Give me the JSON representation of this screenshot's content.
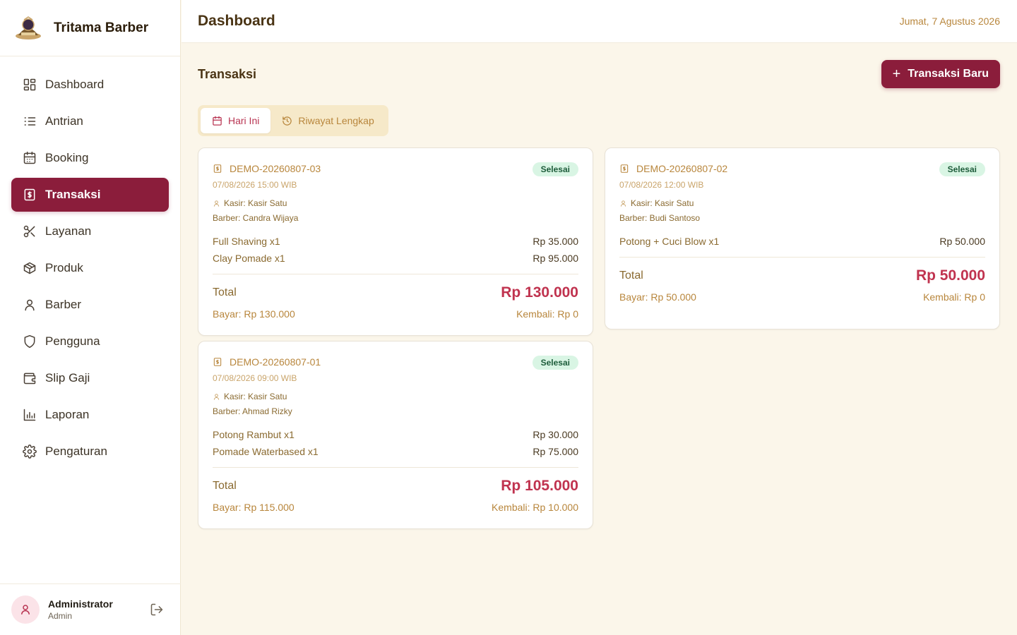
{
  "brand": {
    "name": "Tritama Barber",
    "logo_icon": "barbershop-logo-icon"
  },
  "sidebar": {
    "items": [
      {
        "label": "Dashboard",
        "icon": "dashboard-icon",
        "active": false
      },
      {
        "label": "Antrian",
        "icon": "list-icon",
        "active": false
      },
      {
        "label": "Booking",
        "icon": "calendar-icon",
        "active": false
      },
      {
        "label": "Transaksi",
        "icon": "receipt-icon",
        "active": true
      },
      {
        "label": "Layanan",
        "icon": "scissors-icon",
        "active": false
      },
      {
        "label": "Produk",
        "icon": "package-icon",
        "active": false
      },
      {
        "label": "Barber",
        "icon": "user-icon",
        "active": false
      },
      {
        "label": "Pengguna",
        "icon": "shield-icon",
        "active": false
      },
      {
        "label": "Slip Gaji",
        "icon": "wallet-icon",
        "active": false
      },
      {
        "label": "Laporan",
        "icon": "bar-chart-icon",
        "active": false
      },
      {
        "label": "Pengaturan",
        "icon": "gear-icon",
        "active": false
      }
    ]
  },
  "user": {
    "name": "Administrator",
    "role": "Admin"
  },
  "header": {
    "title": "Dashboard",
    "date": "Jumat, 7 Agustus 2026"
  },
  "section": {
    "title": "Transaksi",
    "new_button": "Transaksi Baru"
  },
  "tabs": [
    {
      "label": "Hari Ini",
      "active": true
    },
    {
      "label": "Riwayat Lengkap",
      "active": false
    }
  ],
  "transactions": [
    {
      "id": "DEMO-20260807-03",
      "time": "07/08/2026 15:00 WIB",
      "status": "Selesai",
      "kasir": "Kasir: Kasir Satu",
      "barber": "Barber: Candra Wijaya",
      "items": [
        {
          "name": "Full Shaving x1",
          "price": "Rp 35.000"
        },
        {
          "name": "Clay Pomade x1",
          "price": "Rp 95.000"
        }
      ],
      "total_label": "Total",
      "total": "Rp 130.000",
      "bayar": "Bayar: Rp 130.000",
      "kembali": "Kembali: Rp 0"
    },
    {
      "id": "DEMO-20260807-02",
      "time": "07/08/2026 12:00 WIB",
      "status": "Selesai",
      "kasir": "Kasir: Kasir Satu",
      "barber": "Barber: Budi Santoso",
      "items": [
        {
          "name": "Potong + Cuci Blow x1",
          "price": "Rp 50.000"
        }
      ],
      "total_label": "Total",
      "total": "Rp 50.000",
      "bayar": "Bayar: Rp 50.000",
      "kembali": "Kembali: Rp 0"
    },
    {
      "id": "DEMO-20260807-01",
      "time": "07/08/2026 09:00 WIB",
      "status": "Selesai",
      "kasir": "Kasir: Kasir Satu",
      "barber": "Barber: Ahmad Rizky",
      "items": [
        {
          "name": "Potong Rambut x1",
          "price": "Rp 30.000"
        },
        {
          "name": "Pomade Waterbased x1",
          "price": "Rp 75.000"
        }
      ],
      "total_label": "Total",
      "total": "Rp 105.000",
      "bayar": "Bayar: Rp 115.000",
      "kembali": "Kembali: Rp 10.000"
    }
  ],
  "colors": {
    "accent": "#8b1d3b",
    "gold": "#b8863c",
    "background": "#fbf6ea",
    "badge_bg": "#d9f5e4"
  }
}
